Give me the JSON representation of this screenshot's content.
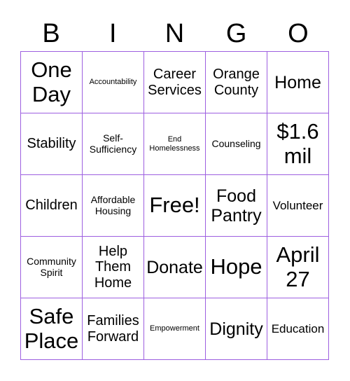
{
  "header": [
    "B",
    "I",
    "N",
    "G",
    "O"
  ],
  "grid_color": "#9d5fe0",
  "cells": [
    {
      "text": "One Day",
      "size": "xl"
    },
    {
      "text": "Accountability",
      "size": "xxs"
    },
    {
      "text": "Career Services",
      "size": "md"
    },
    {
      "text": "Orange County",
      "size": "md"
    },
    {
      "text": "Home",
      "size": "lg"
    },
    {
      "text": "Stability",
      "size": "md"
    },
    {
      "text": "Self-Sufficiency",
      "size": "xs"
    },
    {
      "text": "End Homelessness",
      "size": "xxs"
    },
    {
      "text": "Counseling",
      "size": "xs"
    },
    {
      "text": "$1.6 mil",
      "size": "xl"
    },
    {
      "text": "Children",
      "size": "md"
    },
    {
      "text": "Affordable Housing",
      "size": "xs"
    },
    {
      "text": "Free!",
      "size": "xl"
    },
    {
      "text": "Food Pantry",
      "size": "lg"
    },
    {
      "text": "Volunteer",
      "size": "sm"
    },
    {
      "text": "Community Spirit",
      "size": "xs"
    },
    {
      "text": "Help Them Home",
      "size": "md"
    },
    {
      "text": "Donate",
      "size": "lg"
    },
    {
      "text": "Hope",
      "size": "xl"
    },
    {
      "text": "April 27",
      "size": "xl"
    },
    {
      "text": "Safe Place",
      "size": "xl"
    },
    {
      "text": "Families Forward",
      "size": "md"
    },
    {
      "text": "Empowerment",
      "size": "xxs"
    },
    {
      "text": "Dignity",
      "size": "lg"
    },
    {
      "text": "Education",
      "size": "sm"
    }
  ]
}
